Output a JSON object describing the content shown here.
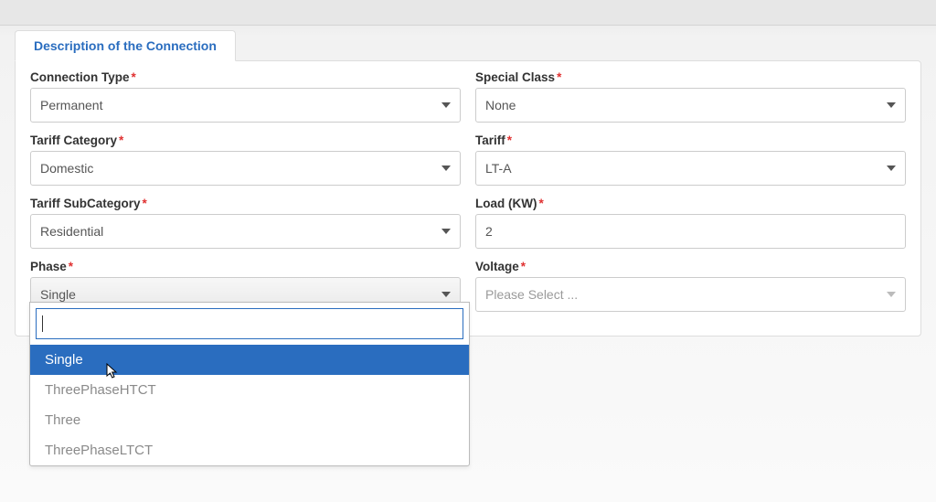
{
  "section_title": "Description of the Connection",
  "left": {
    "connection_type": {
      "label": "Connection Type",
      "value": "Permanent"
    },
    "tariff_category": {
      "label": "Tariff Category",
      "value": "Domestic"
    },
    "tariff_subcategory": {
      "label": "Tariff SubCategory",
      "value": "Residential"
    },
    "phase": {
      "label": "Phase",
      "value": "Single",
      "search": "",
      "options": [
        "Single",
        "ThreePhaseHTCT",
        "Three",
        "ThreePhaseLTCT"
      ]
    }
  },
  "right": {
    "special_class": {
      "label": "Special Class",
      "value": "None"
    },
    "tariff": {
      "label": "Tariff",
      "value": "LT-A"
    },
    "load_kw": {
      "label": "Load (KW)",
      "value": "2"
    },
    "voltage": {
      "label": "Voltage",
      "placeholder": "Please Select ..."
    }
  }
}
